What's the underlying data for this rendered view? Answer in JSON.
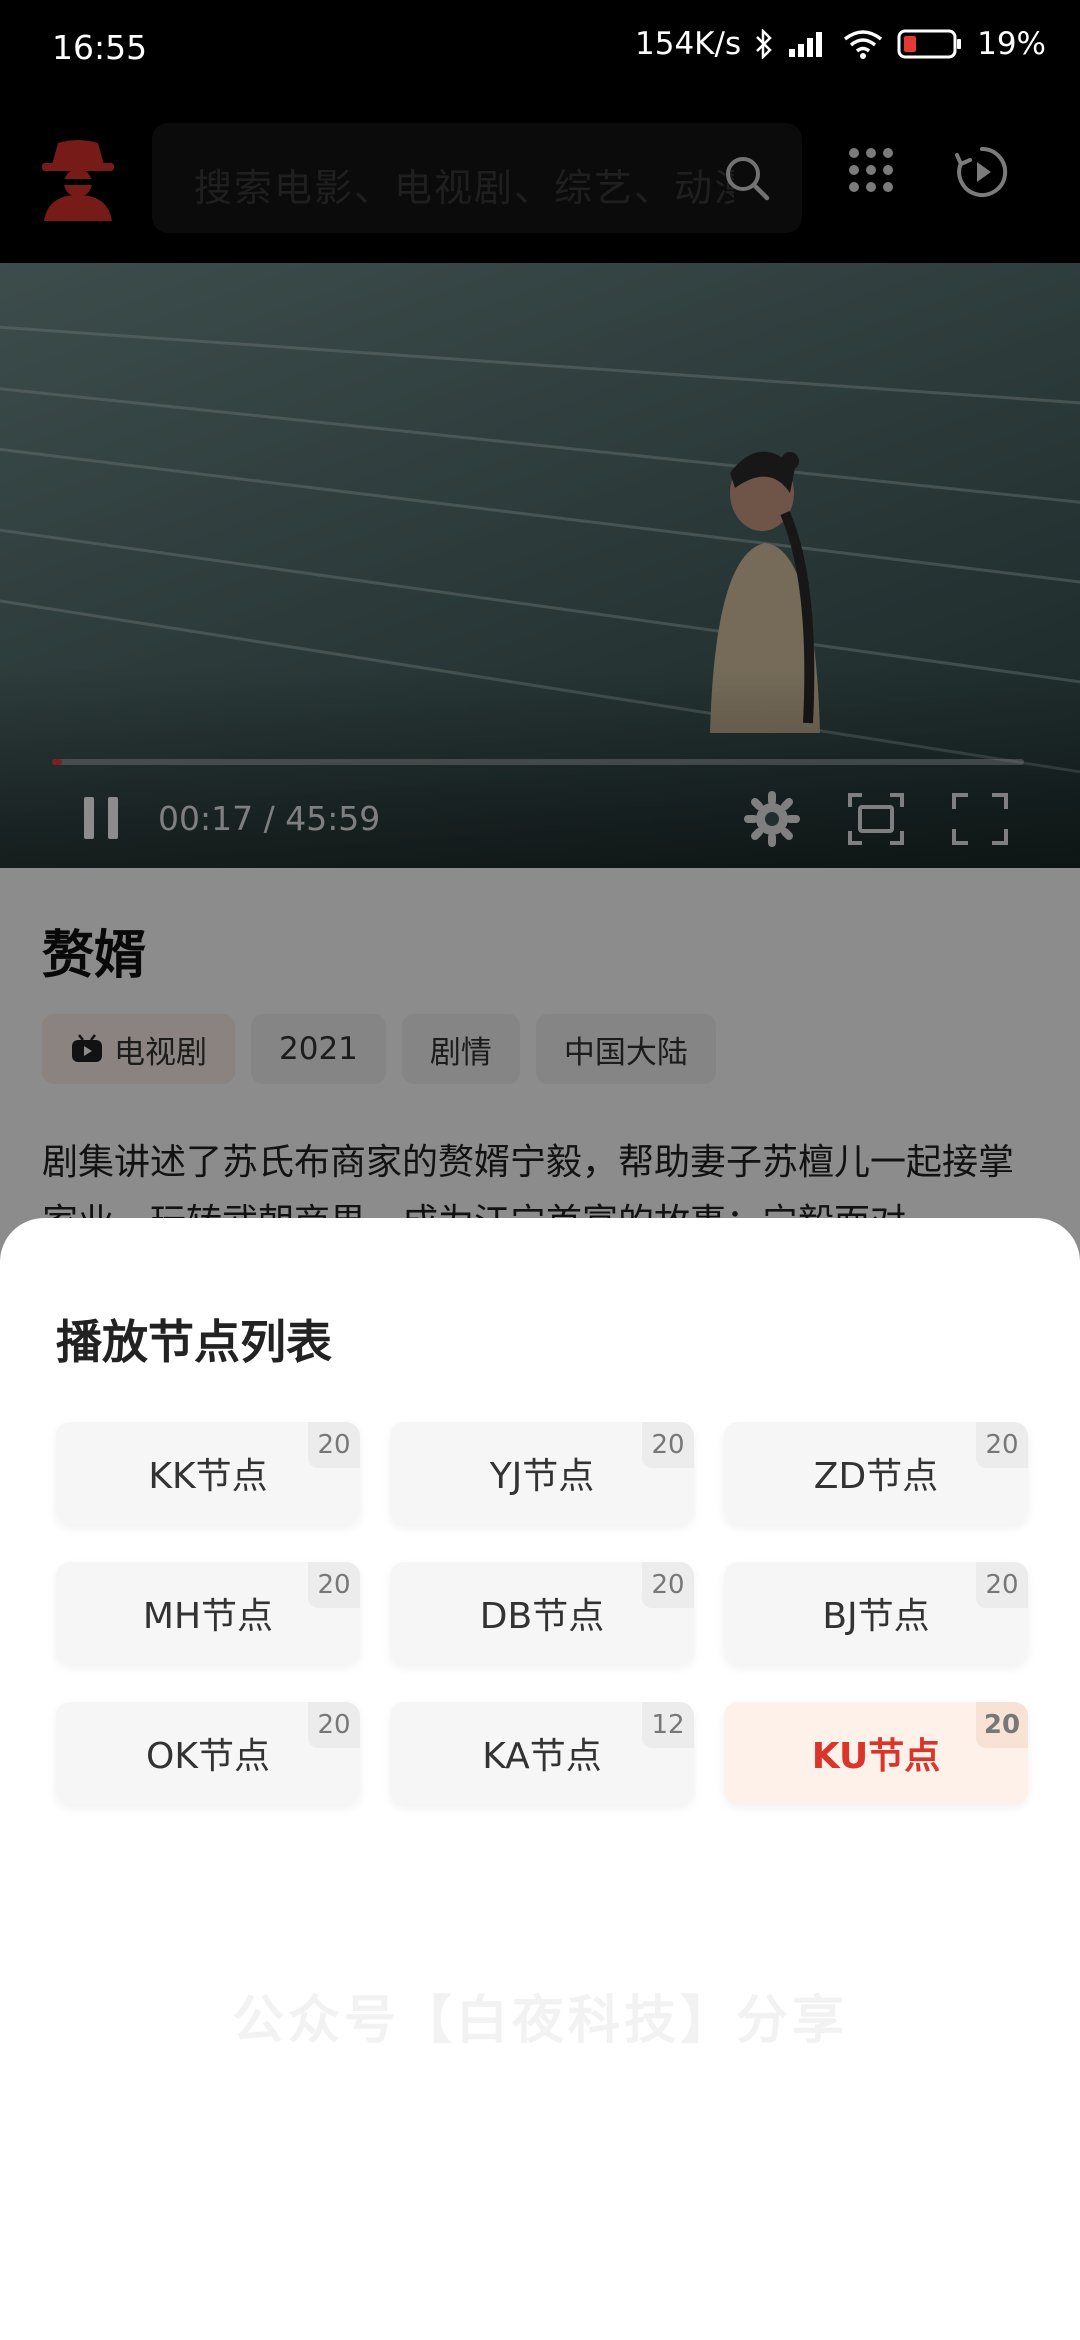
{
  "status_bar": {
    "time": "16:55",
    "net_speed": "154K/s",
    "battery": "19%"
  },
  "header": {
    "search_placeholder": "搜索电影、电视剧、综艺、动漫"
  },
  "player": {
    "time_display": "00:17 / 45:59",
    "progress": 0.006
  },
  "show": {
    "title": "赘婿",
    "tags": [
      "电视剧",
      "2021",
      "剧情",
      "中国大陆"
    ],
    "description": "剧集讲述了苏氏布商家的赘婿宁毅，帮助妻子苏檀儿一起接掌家业、玩转武朝商界、成为江宁首富的故事；宁毅面对"
  },
  "sheet": {
    "title": "播放节点列表",
    "nodes": [
      {
        "label": "KK节点",
        "count": "20"
      },
      {
        "label": "YJ节点",
        "count": "20"
      },
      {
        "label": "ZD节点",
        "count": "20"
      },
      {
        "label": "MH节点",
        "count": "20"
      },
      {
        "label": "DB节点",
        "count": "20"
      },
      {
        "label": "BJ节点",
        "count": "20"
      },
      {
        "label": "OK节点",
        "count": "20"
      },
      {
        "label": "KA节点",
        "count": "12"
      },
      {
        "label": "KU节点",
        "count": "20",
        "selected": true
      }
    ],
    "watermark": "公众号【白夜科技】分享"
  },
  "colors": {
    "accent": "#d9352a",
    "progress": "#e53935"
  }
}
